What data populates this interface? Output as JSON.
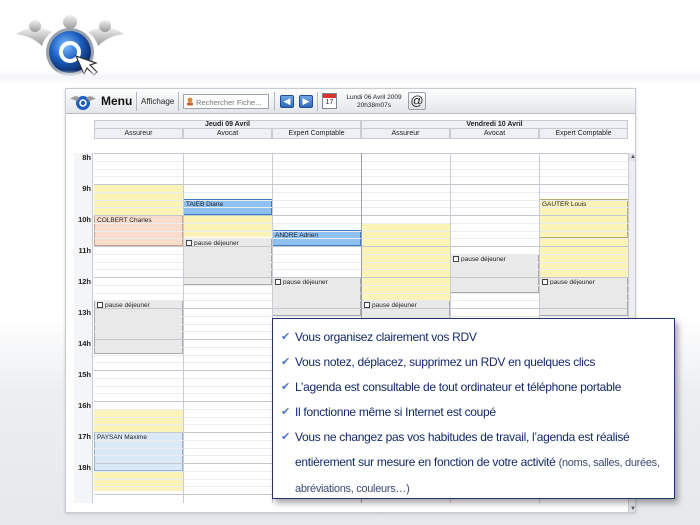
{
  "toolbar": {
    "menu_label": "Menu",
    "affichage_label": "Affichage",
    "search_placeholder": "Rechercher Fiche...",
    "calendar_day": "17",
    "date_line": "Lundi 06 Avril 2009",
    "time_line": "20h38m07s",
    "at_label": "@"
  },
  "calendar": {
    "days": [
      {
        "title": "Jeudi 09 Avril",
        "columns": [
          "Assureur",
          "Avocat",
          "Expert Comptable"
        ]
      },
      {
        "title": "Vendredi 10 Avril",
        "columns": [
          "Assureur",
          "Avocat",
          "Expert Comptable"
        ]
      }
    ],
    "hours": [
      "8h",
      "9h",
      "10h",
      "11h",
      "12h",
      "13h",
      "14h",
      "15h",
      "16h",
      "17h",
      "18h"
    ],
    "events": {
      "colbert": "COLBERT Charles",
      "taieb": "TAIEB Diane",
      "andre": "ANDRE Adrien",
      "gauter": "GAUTER Louis",
      "paysan": "PAYSAN Maxime",
      "pause": "pause déjeuner"
    }
  },
  "callout": {
    "items": [
      "Vous organisez clairement vos RDV",
      "Vous notez, déplacez, supprimez un RDV en quelques clics",
      "L’agenda est consultable de tout ordinateur et téléphone portable",
      "Il fonctionne même si Internet est coupé",
      "Vous ne changez pas vos habitudes de travail, l’agenda est réalisé entièrement sur mesure en fonction de votre activité"
    ],
    "note": "(noms, salles, durées, abréviations, couleurs…)"
  },
  "colors": {
    "yellow_slot": "#fbf3b8",
    "appointment_blue": "#8ec1f2",
    "callout_text": "#13286b",
    "check": "#4a78c2"
  },
  "icons": [
    "brand-logo-icon",
    "search-icon",
    "arrow-left-icon",
    "arrow-right-icon",
    "calendar-icon",
    "at-icon",
    "check-icon",
    "pause-icon"
  ]
}
